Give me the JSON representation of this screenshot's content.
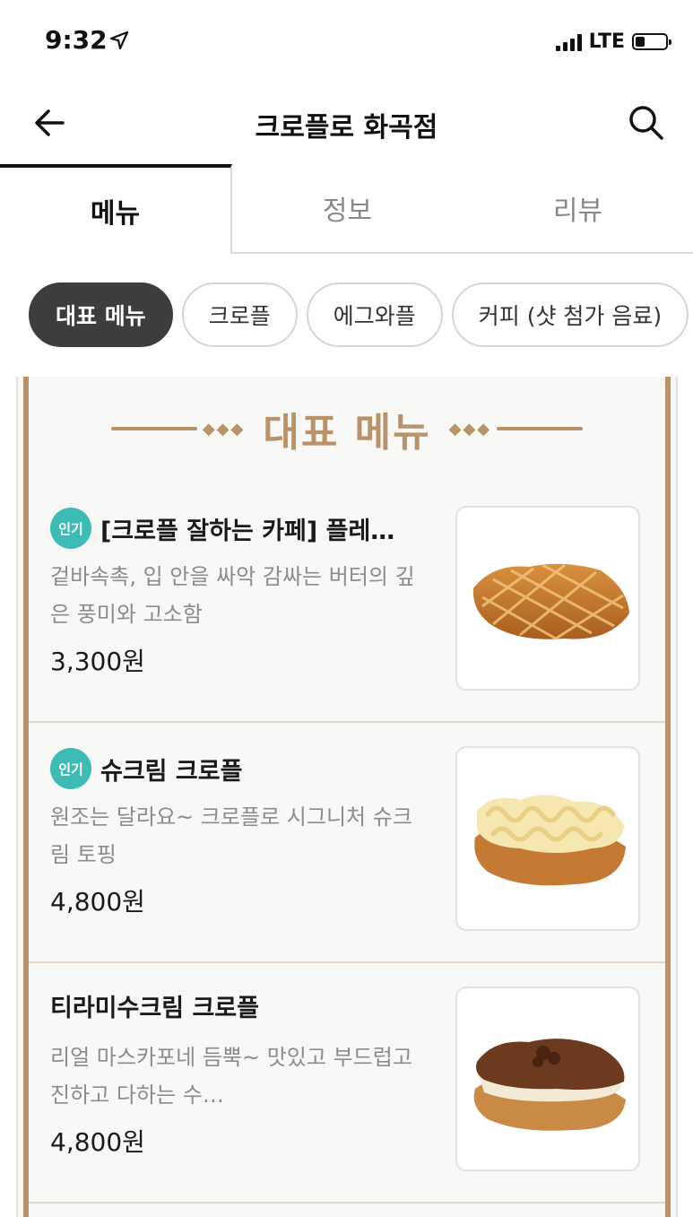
{
  "status_bar": {
    "time": "9:32",
    "network": "LTE",
    "battery_level": 0.25
  },
  "header": {
    "title": "크로플로 화곡점"
  },
  "tabs": [
    {
      "label": "메뉴",
      "active": true
    },
    {
      "label": "정보",
      "active": false
    },
    {
      "label": "리뷰",
      "active": false
    }
  ],
  "categories": [
    {
      "label": "대표 메뉴",
      "active": true
    },
    {
      "label": "크로플",
      "active": false
    },
    {
      "label": "에그와플",
      "active": false
    },
    {
      "label": "커피 (샷 첨가 음료)",
      "active": false
    }
  ],
  "section": {
    "title": "대표 메뉴"
  },
  "menu_items": [
    {
      "badge": "인기",
      "name": "[크로플 잘하는 카페] 플레…",
      "description": "겉바속촉, 입 안을 싸악 감싸는 버터의 깊은 풍미와 고소함",
      "price": "3,300원",
      "image_icon": "plain-croffle-image"
    },
    {
      "badge": "인기",
      "name": "슈크림 크로플",
      "description": "원조는 달라요~ 크로플로 시그니처 슈크림 토핑",
      "price": "4,800원",
      "image_icon": "cream-croffle-image"
    },
    {
      "badge": "",
      "name": "티라미수크림 크로플",
      "description": "리얼 마스카포네 듬뿍~ 맛있고 부드럽고 진하고 다하는 수…",
      "price": "4,800원",
      "image_icon": "tiramisu-croffle-image"
    }
  ],
  "colors": {
    "accent_gold": "#b8936a",
    "badge_teal": "#3cbcb4",
    "active_chip": "#3d3d3d"
  }
}
